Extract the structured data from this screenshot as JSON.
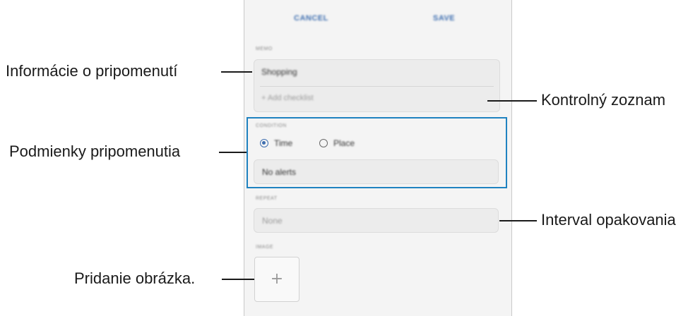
{
  "screen": {
    "top_bar": {
      "cancel_label": "CANCEL",
      "save_label": "SAVE"
    },
    "memo": {
      "section_label": "MEMO",
      "title_value": "Shopping",
      "checklist_placeholder": "+ Add checklist"
    },
    "condition": {
      "section_label": "CONDITION",
      "options": [
        {
          "label": "Time",
          "selected": true
        },
        {
          "label": "Place",
          "selected": false
        }
      ],
      "alert_value": "No alerts"
    },
    "repeat": {
      "section_label": "REPEAT",
      "value": "None"
    },
    "image": {
      "section_label": "IMAGE",
      "add_symbol": "+"
    }
  },
  "callouts": {
    "reminder_info": "Informácie o pripomenutí",
    "checklist": "Kontrolný zoznam",
    "conditions": "Podmienky pripomenutia",
    "repeat_interval": "Interval opakovania",
    "add_image": "Pridanie obrázka."
  },
  "colors": {
    "accent": "#3f6fb0",
    "highlight": "#1f82c0"
  }
}
